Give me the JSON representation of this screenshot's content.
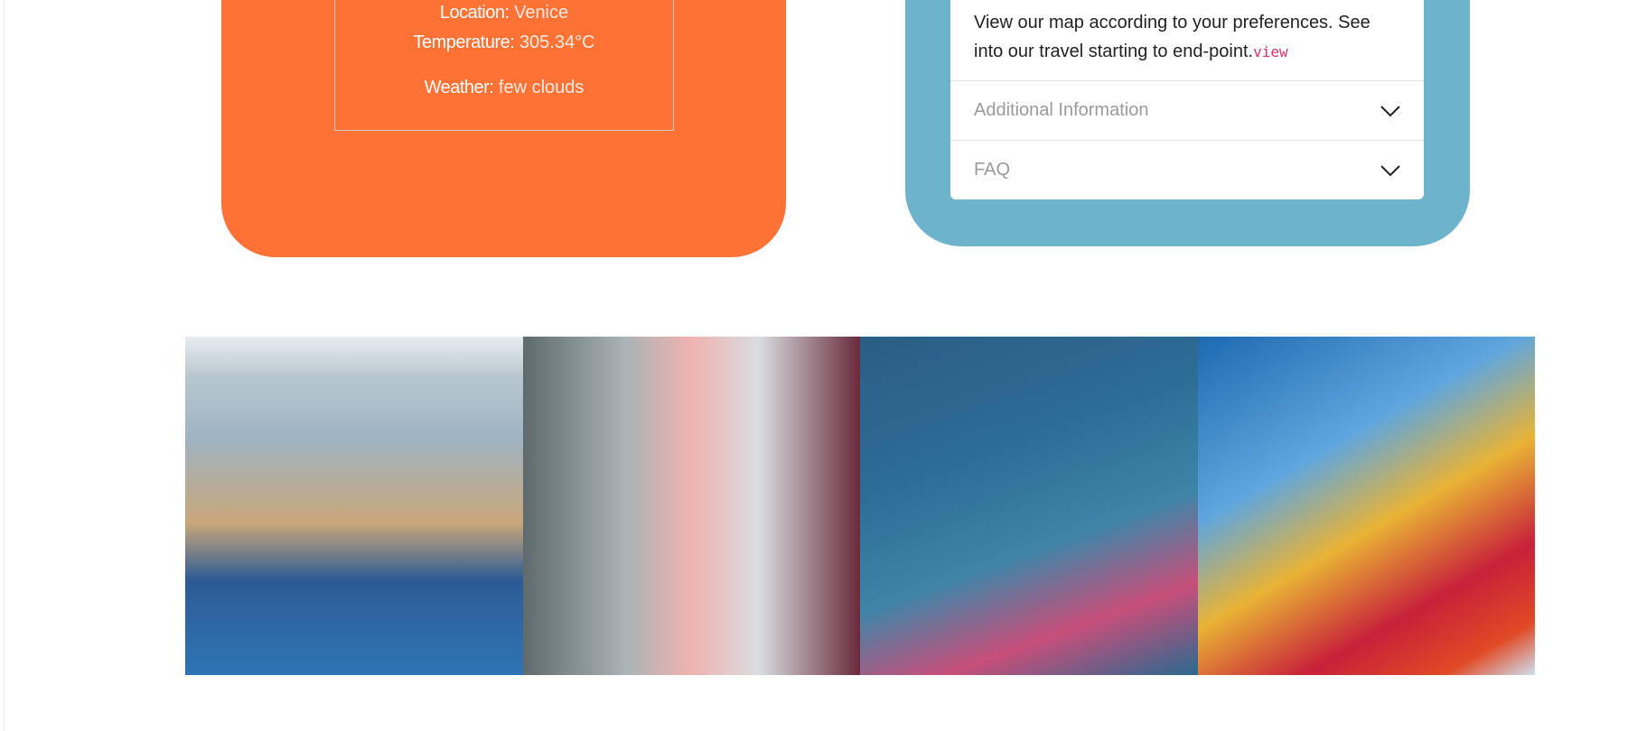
{
  "weather_card": {
    "location_label": "Location:",
    "location_value": "Venice",
    "temperature_label": "Temperature:",
    "temperature_value": "305.34°C",
    "weather_label": "Weather:",
    "weather_value": "few clouds"
  },
  "info_card": {
    "description": "View our map according to your preferences. See into our travel starting to end-point.",
    "code_snippet": "view",
    "accordion": [
      {
        "label": "Additional Information",
        "icon": "chevron-down-icon"
      },
      {
        "label": "FAQ",
        "icon": "chevron-down-icon"
      }
    ]
  },
  "colors": {
    "orange": "#fe7335",
    "blue": "#6db3cb",
    "code": "#d6336c"
  }
}
